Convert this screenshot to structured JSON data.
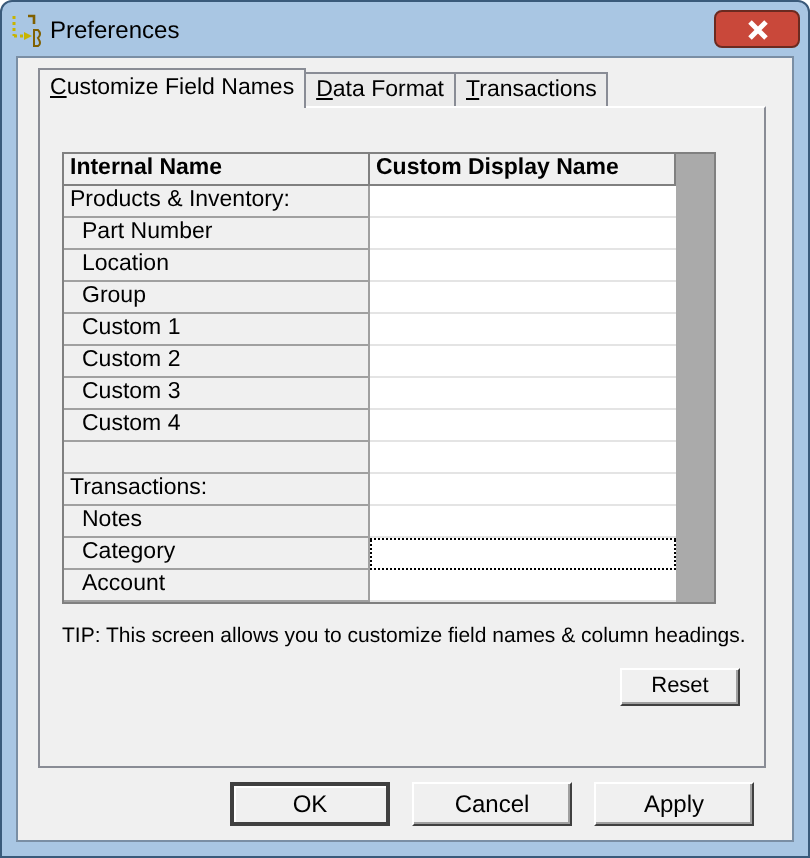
{
  "window": {
    "title": "Preferences"
  },
  "tabs": [
    {
      "label": "Customize Field Names",
      "selected": true
    },
    {
      "label": "Data Format",
      "selected": false
    },
    {
      "label": "Transactions",
      "selected": false
    }
  ],
  "table": {
    "columns": [
      "Internal Name",
      "Custom Display Name"
    ],
    "rows": [
      {
        "kind": "section",
        "name": "Products & Inventory:",
        "focused": false
      },
      {
        "kind": "item",
        "name": "Part Number",
        "focused": false
      },
      {
        "kind": "item",
        "name": "Location",
        "focused": false
      },
      {
        "kind": "item",
        "name": "Group",
        "focused": false
      },
      {
        "kind": "item",
        "name": "Custom 1",
        "focused": false
      },
      {
        "kind": "item",
        "name": "Custom 2",
        "focused": false
      },
      {
        "kind": "item",
        "name": "Custom 3",
        "focused": false
      },
      {
        "kind": "item",
        "name": "Custom 4",
        "focused": false
      },
      {
        "kind": "blank",
        "focused": false
      },
      {
        "kind": "section",
        "name": "Transactions:",
        "focused": false
      },
      {
        "kind": "item",
        "name": "Notes",
        "focused": false
      },
      {
        "kind": "item",
        "name": "Category",
        "focused": true
      },
      {
        "kind": "item",
        "name": "Account",
        "focused": false
      }
    ]
  },
  "tip": "TIP: This screen allows you to customize field names & column headings.",
  "reset_button": "Reset",
  "buttons": [
    {
      "label": "OK",
      "default": true
    },
    {
      "label": "Cancel",
      "default": false
    },
    {
      "label": "Apply",
      "default": false
    }
  ]
}
